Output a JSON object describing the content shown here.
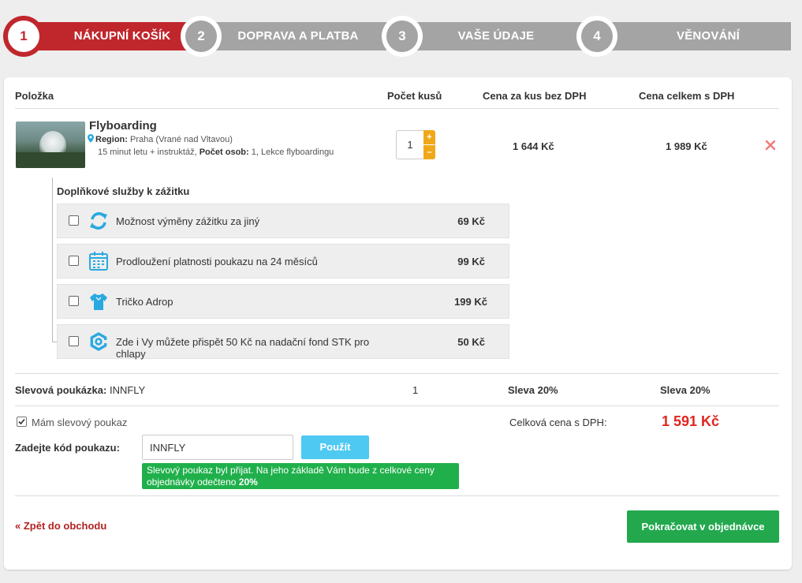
{
  "steps": [
    {
      "number": "1",
      "label": "NÁKUPNÍ KOŠÍK",
      "active": true
    },
    {
      "number": "2",
      "label": "DOPRAVA A PLATBA",
      "active": false
    },
    {
      "number": "3",
      "label": "VAŠE ÚDAJE",
      "active": false
    },
    {
      "number": "4",
      "label": "VĚNOVÁNÍ",
      "active": false
    }
  ],
  "table": {
    "headers": [
      "Položka",
      "Počet kusů",
      "Cena za kus bez DPH",
      "Cena celkem s DPH"
    ]
  },
  "item": {
    "name": "Flyboarding",
    "region_label": "Region:",
    "region_value": "Praha (Vrané nad Vltavou)",
    "desc_pre": "15 minut letu + instruktáž,",
    "persons_label": "Počet osob:",
    "desc_post": "1, Lekce flyboardingu",
    "quantity": "1",
    "plus": "+",
    "minus": "–",
    "unit_price": "1 644 Kč",
    "total_price": "1 989 Kč"
  },
  "addons": {
    "title": "Doplňkové služby k zážitku",
    "items": [
      {
        "label": "Možnost výměny zážitku za jiný",
        "price": "69 Kč",
        "icon": "exchange-icon"
      },
      {
        "label": "Prodloužení platnosti poukazu na 24 měsíců",
        "price": "99 Kč",
        "icon": "calendar-icon"
      },
      {
        "label": "Tričko Adrop",
        "price": "199 Kč",
        "icon": "tshirt-icon"
      },
      {
        "label": "Zde i Vy můžete přispět 50 Kč na nadační fond STK pro chlapy",
        "price": "50 Kč",
        "icon": "gear-icon"
      }
    ]
  },
  "discount": {
    "label": "Slevová poukázka:",
    "code": "INNFLY",
    "qty": "1",
    "unit": "Sleva 20%",
    "total": "Sleva 20%"
  },
  "voucher": {
    "checkbox_label": "Mám slevový poukaz",
    "checked": true,
    "code_label": "Zadejte kód poukazu:",
    "code_value": "INNFLY",
    "apply_label": "Použít",
    "success_text": "Slevový poukaz byl přijat. Na jeho základě Vám bude z celkové ceny objednávky odečteno",
    "success_pct": "20%"
  },
  "summary": {
    "total_label": "Celková cena s DPH:",
    "total_value": "1 591 Kč"
  },
  "footer": {
    "back_label": "« Zpět do obchodu",
    "continue_label": "Pokračovat v objednávce"
  },
  "colors": {
    "active_step": "#c0272d",
    "inactive_step": "#a4a4a4",
    "accent_orange": "#f0a81b",
    "icon_blue": "#29a9e0",
    "apply_button": "#4dc9f2",
    "success": "#20b04b",
    "total_price": "#e0261f",
    "continue_button": "#23a84e",
    "back_link": "#b22222"
  }
}
